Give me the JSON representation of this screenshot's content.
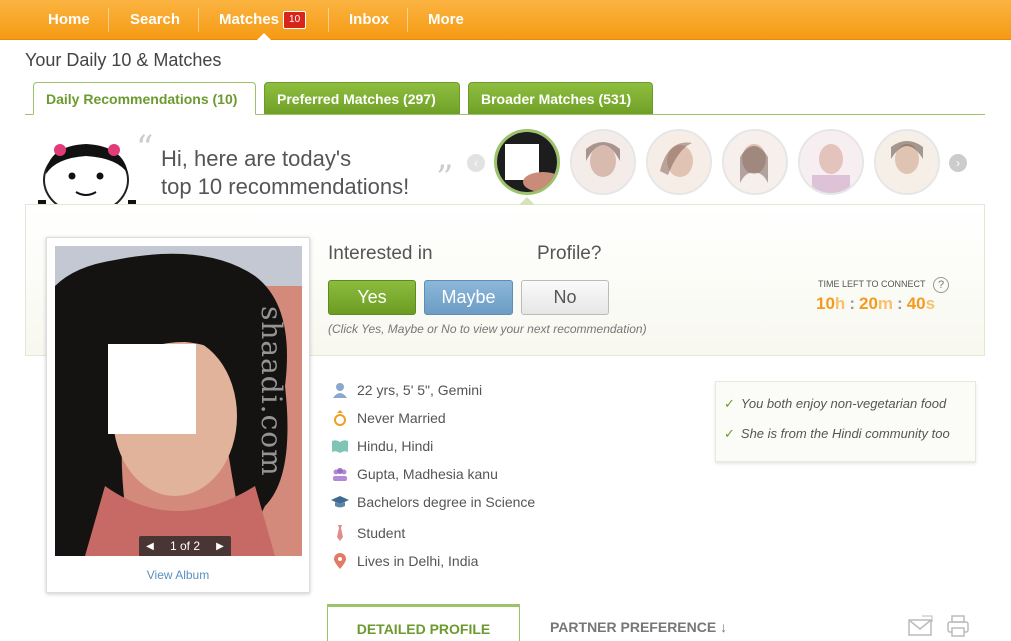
{
  "nav": {
    "items": [
      {
        "label": "Home"
      },
      {
        "label": "Search"
      },
      {
        "label": "Matches",
        "badge": "10"
      },
      {
        "label": "Inbox"
      },
      {
        "label": "More"
      }
    ]
  },
  "page": {
    "title": "Your Daily 10 & Matches"
  },
  "tabs": [
    {
      "label": "Daily Recommendations (10)",
      "active": true
    },
    {
      "label": "Preferred Matches (297)"
    },
    {
      "label": "Broader Matches (531)"
    }
  ],
  "greeting": {
    "line1": "Hi, here are today's",
    "line2": "top 10 recommendations!"
  },
  "interest": {
    "question_start": "Interested in",
    "question_end": "Profile?",
    "yes_label": "Yes",
    "maybe_label": "Maybe",
    "no_label": "No",
    "hint": "(Click Yes, Maybe or No to view your next recommendation)"
  },
  "timer": {
    "label": "TIME LEFT TO CONNECT",
    "hours": "10",
    "hours_unit": "h",
    "minutes": "20",
    "minutes_unit": "m",
    "seconds": "40",
    "seconds_unit": "s",
    "help": "?"
  },
  "photo": {
    "counter": "1 of 2",
    "view_album": "View Album",
    "watermark": "shaadi.com"
  },
  "profile": {
    "details": [
      {
        "icon": "person-icon",
        "text": "22 yrs, 5' 5\", Gemini"
      },
      {
        "icon": "ring-icon",
        "text": "Never Married"
      },
      {
        "icon": "book-icon",
        "text": "Hindu, Hindi"
      },
      {
        "icon": "community-icon",
        "text": "Gupta, Madhesia kanu"
      },
      {
        "icon": "graduation-cap-icon",
        "text": "Bachelors degree in Science"
      },
      {
        "icon": "tie-icon",
        "text": "Student"
      },
      {
        "icon": "location-pin-icon",
        "text": "Lives in Delhi, India"
      }
    ]
  },
  "matches": [
    "You both enjoy non-vegetarian food",
    "She is from the Hindi community too"
  ],
  "bottom_tabs": {
    "detailed": "DETAILED PROFILE",
    "partner": "PARTNER PREFERENCE ↓"
  },
  "colors": {
    "brand_orange": "#f5a21f",
    "accent_green": "#7aab2f",
    "maybe_blue": "#7aa7cf"
  }
}
